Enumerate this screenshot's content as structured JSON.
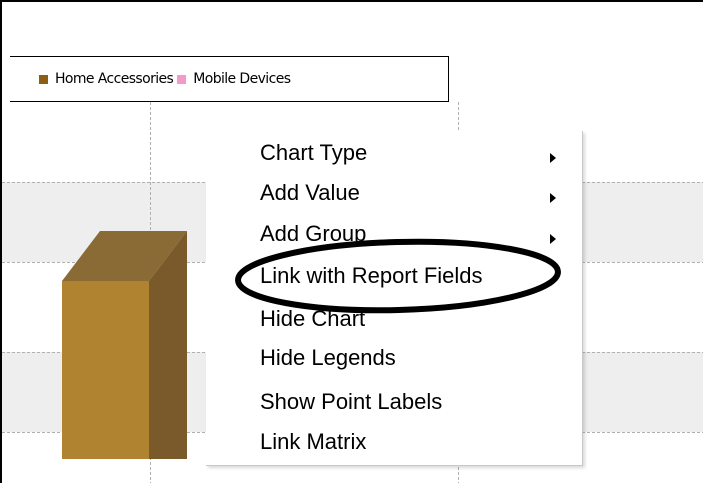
{
  "legend": {
    "items": [
      {
        "label": "Home Accessories",
        "color": "#8b6014"
      },
      {
        "label": "Mobile Devices",
        "color": "#f49ac8"
      }
    ]
  },
  "chart": {
    "bar_color_front": "#b08331",
    "bar_color_side": "#7a5a2a",
    "bar_color_top": "#8a6a35"
  },
  "context_menu": {
    "items": [
      {
        "label": "Chart Type",
        "has_submenu": true
      },
      {
        "label": "Add Value",
        "has_submenu": true
      },
      {
        "label": "Add Group",
        "has_submenu": true
      },
      {
        "label": "Link with Report Fields",
        "has_submenu": false,
        "highlighted": true
      },
      {
        "label": "Hide Chart",
        "has_submenu": false
      },
      {
        "label": "Hide Legends",
        "has_submenu": false
      },
      {
        "label": "Show Point Labels",
        "has_submenu": false
      },
      {
        "label": "Link Matrix",
        "has_submenu": false
      }
    ]
  },
  "annotation": {
    "color": "#000000"
  }
}
